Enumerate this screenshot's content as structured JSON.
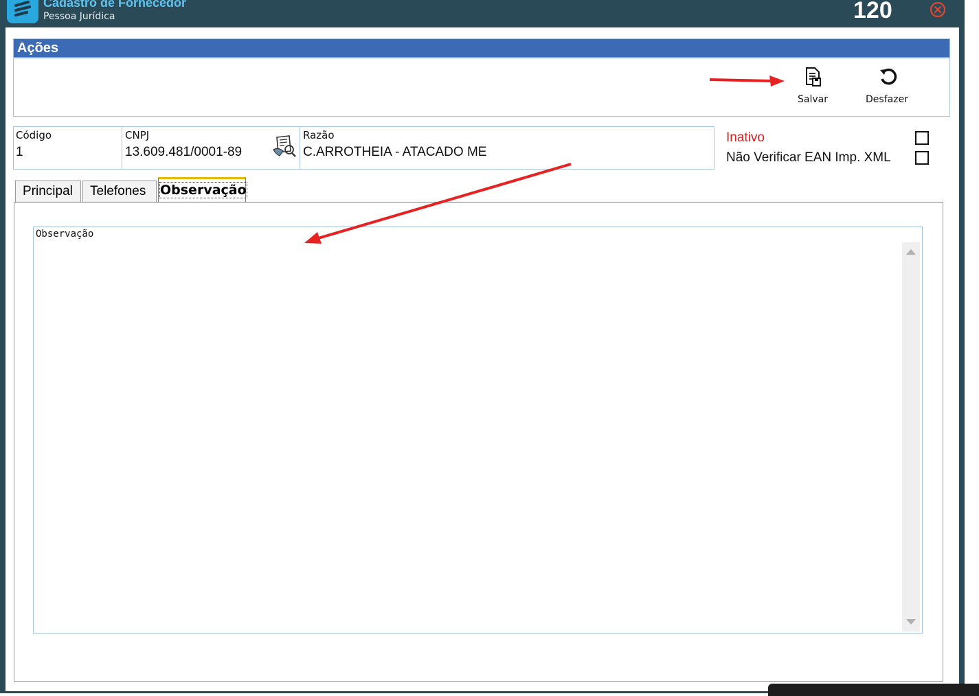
{
  "window": {
    "title": "Cadastro de Fornecedor",
    "subtitle": "Pessoa Jurídica",
    "counter": "120",
    "colors": {
      "titlebar": "#2b4a58",
      "title": "#5fc3f0",
      "header": "#3c6ab4",
      "inactive": "#d32020"
    }
  },
  "acoes": {
    "header": "Ações",
    "salvar_label": "Salvar",
    "desfazer_label": "Desfazer"
  },
  "fields": {
    "codigo": {
      "label": "Código",
      "value": "1"
    },
    "cnpj": {
      "label": "CNPJ",
      "value": "13.609.481/0001-89"
    },
    "razao": {
      "label": "Razão",
      "value": "C.ARROTHEIA - ATACADO ME"
    }
  },
  "flags": {
    "inativo_label": "Inativo",
    "nao_verificar_label": "Não Verificar EAN Imp. XML"
  },
  "tabs": [
    {
      "label": "Principal"
    },
    {
      "label": "Telefones"
    },
    {
      "label": "Observação",
      "active": true
    }
  ],
  "observacao": {
    "label": "Observação",
    "value": ""
  }
}
